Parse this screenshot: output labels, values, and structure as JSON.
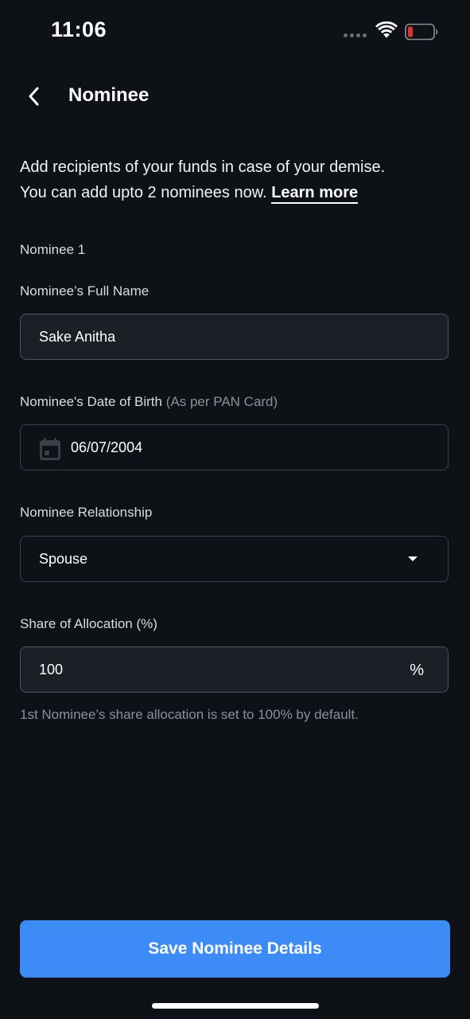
{
  "status_bar": {
    "time": "11:06"
  },
  "header": {
    "title": "Nominee",
    "back_icon": "chevron-left-icon"
  },
  "intro": {
    "line1": "Add recipients of your funds in case of your demise.",
    "line2": "You can add upto 2 nominees now.",
    "learn_more": "Learn more"
  },
  "nominee_section": {
    "heading": "Nominee 1"
  },
  "full_name": {
    "label": "Nominee’s Full Name",
    "value": "Sake Anitha"
  },
  "dob": {
    "label": "Nominee's Date of Birth",
    "hint": "(As per PAN Card)",
    "value": "06/07/2004",
    "icon": "calendar-icon"
  },
  "relationship": {
    "label": "Nominee Relationship",
    "value": "Spouse",
    "icon": "caret-down-icon"
  },
  "allocation": {
    "label": "Share of Allocation (%)",
    "value": "100",
    "suffix": "%",
    "helper": "1st Nominee’s share allocation is set to 100% by default."
  },
  "actions": {
    "save_label": "Save Nominee Details"
  },
  "colors": {
    "background": "#0e1116",
    "accent": "#3d8bf7",
    "field_fill": "#1b2026",
    "muted_text": "#8b9099",
    "battery_low": "#e03030"
  }
}
